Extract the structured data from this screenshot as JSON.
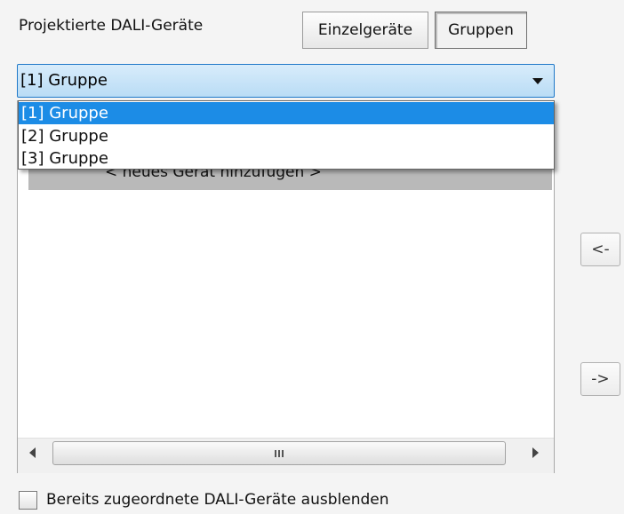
{
  "header": {
    "title": "Projektierte DALI-Geräte",
    "tabs": [
      {
        "label": "Einzelgeräte",
        "active": false
      },
      {
        "label": "Gruppen",
        "active": true
      }
    ]
  },
  "group_select": {
    "selected": "[1] Gruppe",
    "options": [
      "[1] Gruppe",
      "[2] Gruppe",
      "[3] Gruppe"
    ],
    "expanded": true,
    "highlight_color": "#1c8ce6"
  },
  "device_list": {
    "new_item_label": "< neues Gerät hinzufügen >",
    "scrollbar_grip": "III"
  },
  "move_buttons": {
    "left_label": "<-",
    "right_label": "->"
  },
  "hide_assigned": {
    "label": "Bereits zugeordnete DALI-Geräte ausblenden",
    "checked": false
  }
}
